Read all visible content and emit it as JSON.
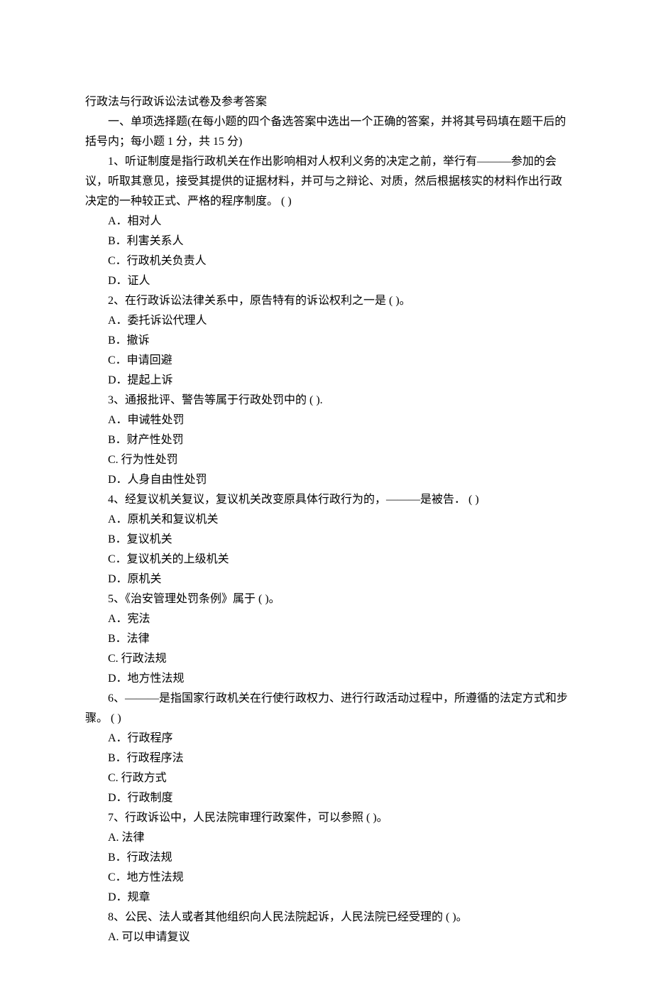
{
  "title": "行政法与行政诉讼法试卷及参考答案",
  "sectionHeader": "一、单项选择题(在每小题的四个备选答案中选出一个正确的答案，并将其号码填在题干后的括号内；每小题 1 分，共 15 分)",
  "questions": [
    {
      "stem": "1、听证制度是指行政机关在作出影响相对人权利义务的决定之前，举行有———参加的会议，听取其意见，接受其提供的证据材料，并可与之辩论、对质，然后根据核实的材料作出行政决定的一种较正式、严格的程序制度。 ( )",
      "options": [
        "A．相对人",
        "B．利害关系人",
        "C．行政机关负责人",
        "D．证人"
      ]
    },
    {
      "stem": "2、在行政诉讼法律关系中，原告特有的诉讼权利之一是 ( )。",
      "options": [
        "A．委托诉讼代理人",
        "B．撤诉",
        "C．申请回避",
        "D．提起上诉"
      ]
    },
    {
      "stem": "3、通报批评、警告等属于行政处罚中的 ( ).",
      "options": [
        "A．申诫牲处罚",
        "B．财产性处罚",
        "C. 行为性处罚",
        "D．人身自由性处罚"
      ]
    },
    {
      "stem": "4、经复议机关复议，复议机关改变原具体行政行为的，———是被告． ( )",
      "options": [
        "A．原机关和复议机关",
        "B．复议机关",
        "C．复议机关的上级机关",
        "D．原机关"
      ]
    },
    {
      "stem": "5、《治安管理处罚条例》属于 ( )。",
      "options": [
        "A．宪法",
        "B．法律",
        "C. 行政法规",
        "D．地方性法规"
      ]
    },
    {
      "stem": "6、———是指国家行政机关在行使行政权力、进行行政活动过程中，所遵循的法定方式和步骤。 ( )",
      "options": [
        "A．行政程序",
        "B．行政程序法",
        "C. 行政方式",
        "D．行政制度"
      ]
    },
    {
      "stem": "7、行政诉讼中，人民法院审理行政案件，可以参照 ( )。",
      "options": [
        "A. 法律",
        "B．行政法规",
        "C．地方性法规",
        "D．规章"
      ]
    },
    {
      "stem": "8、公民、法人或者其他组织向人民法院起诉，人民法院已经受理的 ( )。",
      "options": [
        "A. 可以申请复议"
      ]
    }
  ]
}
